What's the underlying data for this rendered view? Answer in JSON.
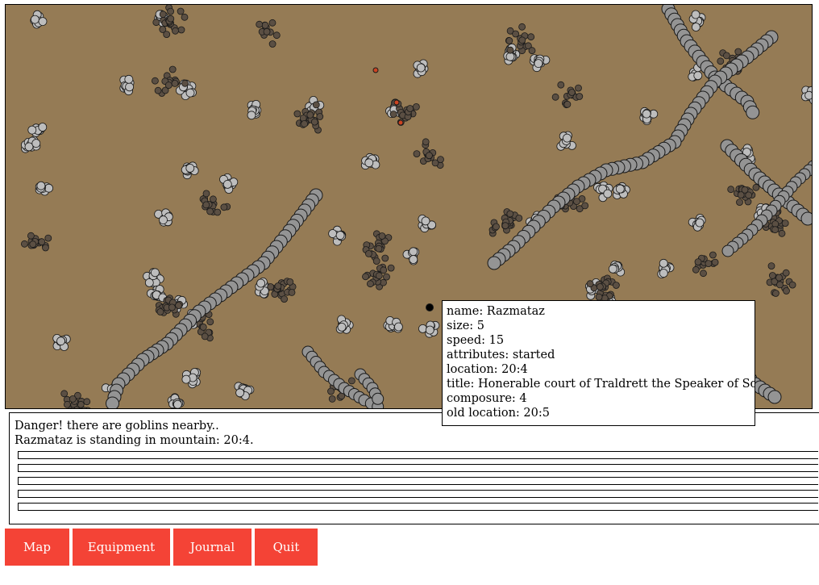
{
  "colors": {
    "ground": "#957b55",
    "road": "#949494",
    "rock_light": "#bdbdbd",
    "rock_dark": "#5b4f43",
    "goblin": "#cc4422",
    "player": "#000000",
    "button": "#f44336"
  },
  "tooltip": {
    "lines": [
      "name: Razmataz",
      "size: 5",
      "speed: 15",
      "attributes: started",
      "location: 20:4",
      "title: Honerable court of Traldrett the Speaker of Soilmoral",
      "composure: 4",
      "old location: 20:5"
    ]
  },
  "log": {
    "messages": [
      "Danger! there are goblins nearby..",
      "Razmataz is standing in mountain: 20:4."
    ]
  },
  "nav": {
    "map": "Map",
    "equipment": "Equipment",
    "journal": "Journal",
    "quit": "Quit"
  }
}
